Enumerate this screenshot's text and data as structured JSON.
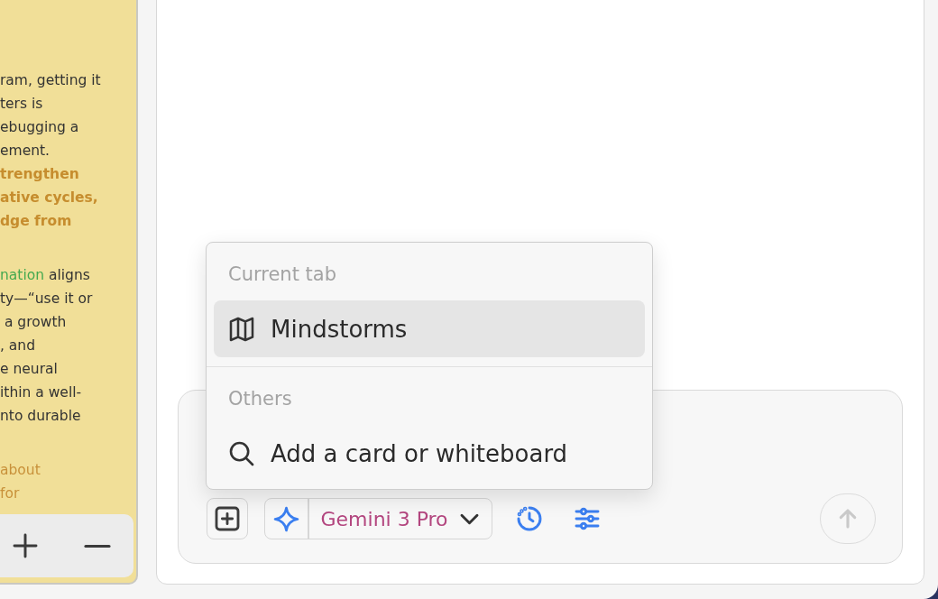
{
  "note_card": {
    "paragraphs": [
      {
        "lines": [
          [
            {
              "kind": "plain",
              "text": "ram, getting it"
            }
          ],
          [
            {
              "kind": "plain",
              "text": "ters is"
            }
          ],
          [
            {
              "kind": "plain",
              "text": "ebugging a"
            }
          ],
          [
            {
              "kind": "plain",
              "text": "ement."
            }
          ],
          [
            {
              "kind": "strong",
              "text": "trengthen"
            }
          ],
          [
            {
              "kind": "strong",
              "text": "ative cycles,"
            }
          ],
          [
            {
              "kind": "strong",
              "text": "dge from"
            }
          ]
        ]
      },
      {
        "lines": [
          [
            {
              "kind": "link",
              "text": "nation"
            },
            {
              "kind": "plain",
              "text": " aligns"
            }
          ],
          [
            {
              "kind": "plain",
              "text": "ty—“use it or"
            }
          ],
          [
            {
              "kind": "plain",
              "text": " a growth"
            }
          ],
          [
            {
              "kind": "plain",
              "text": ", and"
            }
          ],
          [
            {
              "kind": "plain",
              "text": "e neural"
            }
          ],
          [
            {
              "kind": "plain",
              "text": "ithin a well-"
            }
          ],
          [
            {
              "kind": "plain",
              "text": "nto durable"
            }
          ]
        ]
      },
      {
        "lines": [
          [
            {
              "kind": "accent",
              "text": "about"
            }
          ],
          [
            {
              "kind": "accent",
              "text": "for"
            }
          ]
        ]
      }
    ]
  },
  "mention_menu": {
    "sections": [
      {
        "header": "Current tab",
        "items": [
          {
            "kind": "tab",
            "label": "Mindstorms",
            "selected": true
          }
        ]
      },
      {
        "header": "Others",
        "items": [
          {
            "kind": "search",
            "label": "Add a card or whiteboard",
            "selected": false
          }
        ]
      }
    ]
  },
  "composer": {
    "model_label": "Gemini 3 Pro",
    "send_button": {
      "disabled": true
    }
  }
}
